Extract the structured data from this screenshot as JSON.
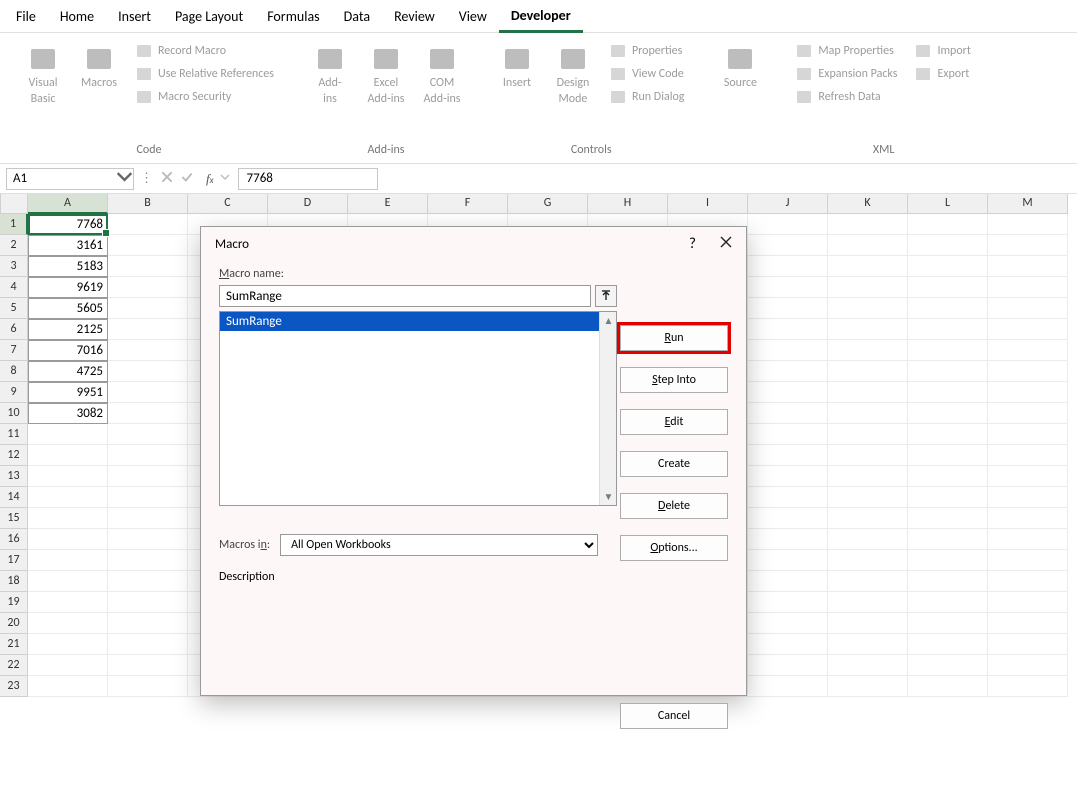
{
  "tabs": [
    "File",
    "Home",
    "Insert",
    "Page Layout",
    "Formulas",
    "Data",
    "Review",
    "View",
    "Developer"
  ],
  "active_tab_index": 8,
  "ribbon": {
    "groups": [
      {
        "label": "Code",
        "big": [
          {
            "name": "visual-basic",
            "line1": "Visual",
            "line2": "Basic"
          },
          {
            "name": "macros",
            "line1": "Macros",
            "line2": ""
          }
        ],
        "small": [
          {
            "name": "record-macro",
            "label": "Record Macro"
          },
          {
            "name": "use-relative",
            "label": "Use Relative References"
          },
          {
            "name": "macro-security",
            "label": "Macro Security"
          }
        ]
      },
      {
        "label": "Add-ins",
        "big": [
          {
            "name": "addins",
            "line1": "Add-",
            "line2": "ins"
          },
          {
            "name": "excel-addins",
            "line1": "Excel",
            "line2": "Add-ins"
          },
          {
            "name": "com-addins",
            "line1": "COM",
            "line2": "Add-ins"
          }
        ],
        "small": []
      },
      {
        "label": "Controls",
        "big": [
          {
            "name": "insert",
            "line1": "Insert",
            "line2": ""
          },
          {
            "name": "design-mode",
            "line1": "Design",
            "line2": "Mode"
          }
        ],
        "small": [
          {
            "name": "properties",
            "label": "Properties"
          },
          {
            "name": "view-code",
            "label": "View Code"
          },
          {
            "name": "run-dialog",
            "label": "Run Dialog"
          }
        ]
      },
      {
        "label": "",
        "big": [
          {
            "name": "source",
            "line1": "Source",
            "line2": ""
          }
        ],
        "small": []
      },
      {
        "label": "XML",
        "big": [],
        "small": [
          {
            "name": "map-properties",
            "label": "Map Properties"
          },
          {
            "name": "expansion-packs",
            "label": "Expansion Packs"
          },
          {
            "name": "refresh-data",
            "label": "Refresh Data"
          }
        ],
        "small2": [
          {
            "name": "import",
            "label": "Import"
          },
          {
            "name": "export",
            "label": "Export"
          }
        ]
      }
    ]
  },
  "name_box": "A1",
  "formula": "7768",
  "columns": [
    "A",
    "B",
    "C",
    "D",
    "E",
    "F",
    "G",
    "H",
    "I",
    "J",
    "K",
    "L",
    "M"
  ],
  "rows": 23,
  "selected_cell": {
    "col": 0,
    "row": 0
  },
  "col_a_values": [
    "7768",
    "3161",
    "5183",
    "9619",
    "5605",
    "2125",
    "7016",
    "4725",
    "9951",
    "3082"
  ],
  "dialog": {
    "title": "Macro",
    "macro_name_label": "Macro name:",
    "macro_name_prefix": "M",
    "name_value": "SumRange",
    "list": [
      "SumRange"
    ],
    "selected_index": 0,
    "buttons": [
      "Run",
      "Step Into",
      "Edit",
      "Create",
      "Delete",
      "Options..."
    ],
    "ul": [
      "R",
      "S",
      "E",
      "",
      "D",
      "O"
    ],
    "cancel": "Cancel",
    "macros_in_label": "Macros in:",
    "macros_in_prefix": "A",
    "macros_in_value": "All Open Workbooks",
    "description_label": "Description"
  }
}
